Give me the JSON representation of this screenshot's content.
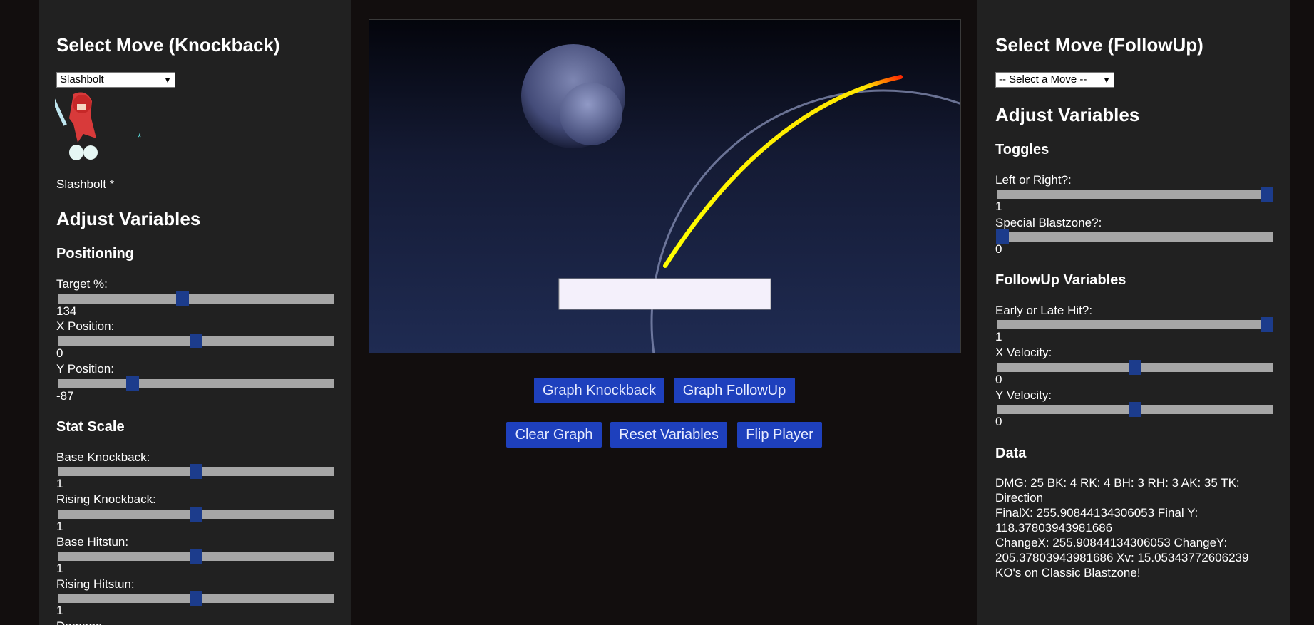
{
  "left": {
    "title": "Select Move (Knockback)",
    "move_select": "Slashbolt",
    "move_caption": "Slashbolt *",
    "star": "*",
    "adjust_title": "Adjust Variables",
    "positioning_title": "Positioning",
    "target_label": "Target %:",
    "target_value": "134",
    "target_fraction": 0.45,
    "xpos_label": "X Position:",
    "xpos_value": "0",
    "xpos_fraction": 0.5,
    "ypos_label": "Y Position:",
    "ypos_value": "-87",
    "ypos_fraction": 0.27,
    "stat_title": "Stat Scale",
    "bk_label": "Base Knockback:",
    "bk_value": "1",
    "rk_label": "Rising Knockback:",
    "rk_value": "1",
    "bh_label": "Base Hitstun:",
    "bh_value": "1",
    "rh_label": "Rising Hitstun:",
    "rh_value": "1",
    "damage_label": "Damage"
  },
  "center": {
    "graph_knockback": "Graph Knockback",
    "graph_followup": "Graph FollowUp",
    "clear_graph": "Clear Graph",
    "reset_variables": "Reset Variables",
    "flip_player": "Flip Player"
  },
  "right": {
    "title": "Select Move (FollowUp)",
    "move_select": "-- Select a Move --",
    "adjust_title": "Adjust Variables",
    "toggles_title": "Toggles",
    "lr_label": "Left or Right?:",
    "lr_value": "1",
    "sb_label": "Special Blastzone?:",
    "sb_value": "0",
    "followup_title": "FollowUp Variables",
    "el_label": "Early or Late Hit?:",
    "el_value": "1",
    "xv_label": "X Velocity:",
    "xv_value": "0",
    "yv_label": "Y Velocity:",
    "yv_value": "0",
    "data_title": "Data",
    "data_line1": "DMG: 25 BK: 4 RK: 4 BH: 3 RH: 3 AK: 35 TK:",
    "data_line2": "Direction",
    "data_line3": "FinalX: 255.90844134306053 Final Y:",
    "data_line4": "118.37803943981686",
    "data_line5": "ChangeX: 255.90844134306053 ChangeY:",
    "data_line6": "205.37803943981686 Xv: 15.05343772606239",
    "data_line7": "KO's on Classic Blastzone!"
  },
  "colors": {
    "panel_bg": "#212121",
    "page_bg": "#120e0e",
    "button_blue": "#1e40bd",
    "thumb_blue": "#1c3c8c",
    "trajectory": "#ffff00"
  }
}
